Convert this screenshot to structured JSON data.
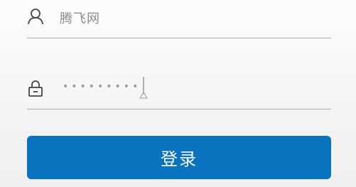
{
  "username_field": {
    "icon": "user-icon",
    "value": "腾飞网"
  },
  "password_field": {
    "icon": "lock-icon",
    "masked_value": "•••••••••"
  },
  "login_button": {
    "label": "登录"
  },
  "colors": {
    "accent": "#0a73c0",
    "underline": "#a9aab0",
    "icon": "#444444",
    "text": "#8c8c8c"
  }
}
